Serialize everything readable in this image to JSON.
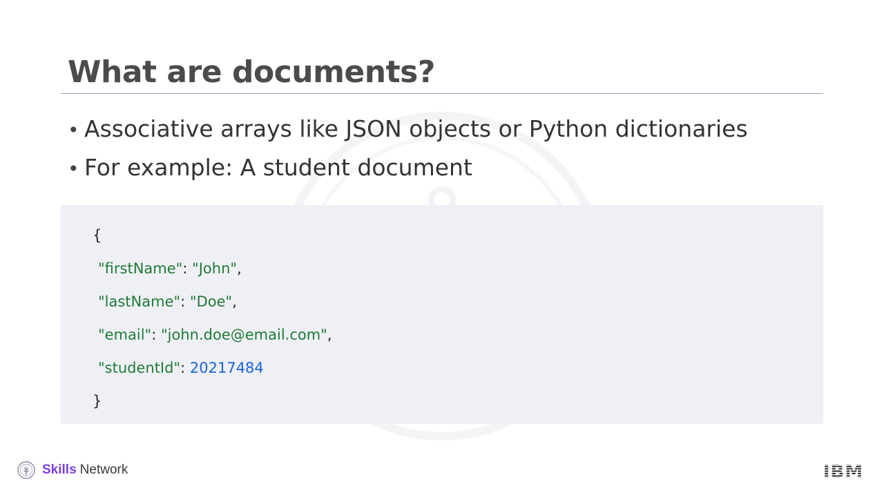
{
  "slide": {
    "title": "What are documents?",
    "bullets": [
      "Associative arrays like JSON objects or Python dictionaries",
      "For example: A student document"
    ]
  },
  "code_example": {
    "open_brace": "{",
    "close_brace": "}",
    "fields": [
      {
        "key": "\"firstName\"",
        "value": "\"John\"",
        "value_type": "string",
        "trailing": ","
      },
      {
        "key": "\"lastName\"",
        "value": "\"Doe\"",
        "value_type": "string",
        "trailing": ","
      },
      {
        "key": "\"email\"",
        "value": "\"john.doe@email.com\"",
        "value_type": "string",
        "trailing": ","
      },
      {
        "key": "\"studentId\"",
        "value": "20217484",
        "value_type": "number",
        "trailing": ""
      }
    ]
  },
  "footer": {
    "brand_primary": "Skills",
    "brand_secondary": "Network",
    "company_logo": "IBM"
  },
  "colors": {
    "code_key": "#1e7a35",
    "code_string": "#1e7a35",
    "code_number": "#1a63d6",
    "brand_purple": "#7b3fe0",
    "panel_bg": "#eeeff4",
    "title_rule": "#9a9ab8"
  },
  "icons": {
    "skills_network_logo": "circular-tree-emblem-icon",
    "ibm_logo": "striped-ibm-wordmark",
    "background_watermark": "circle-watermark-icon"
  }
}
